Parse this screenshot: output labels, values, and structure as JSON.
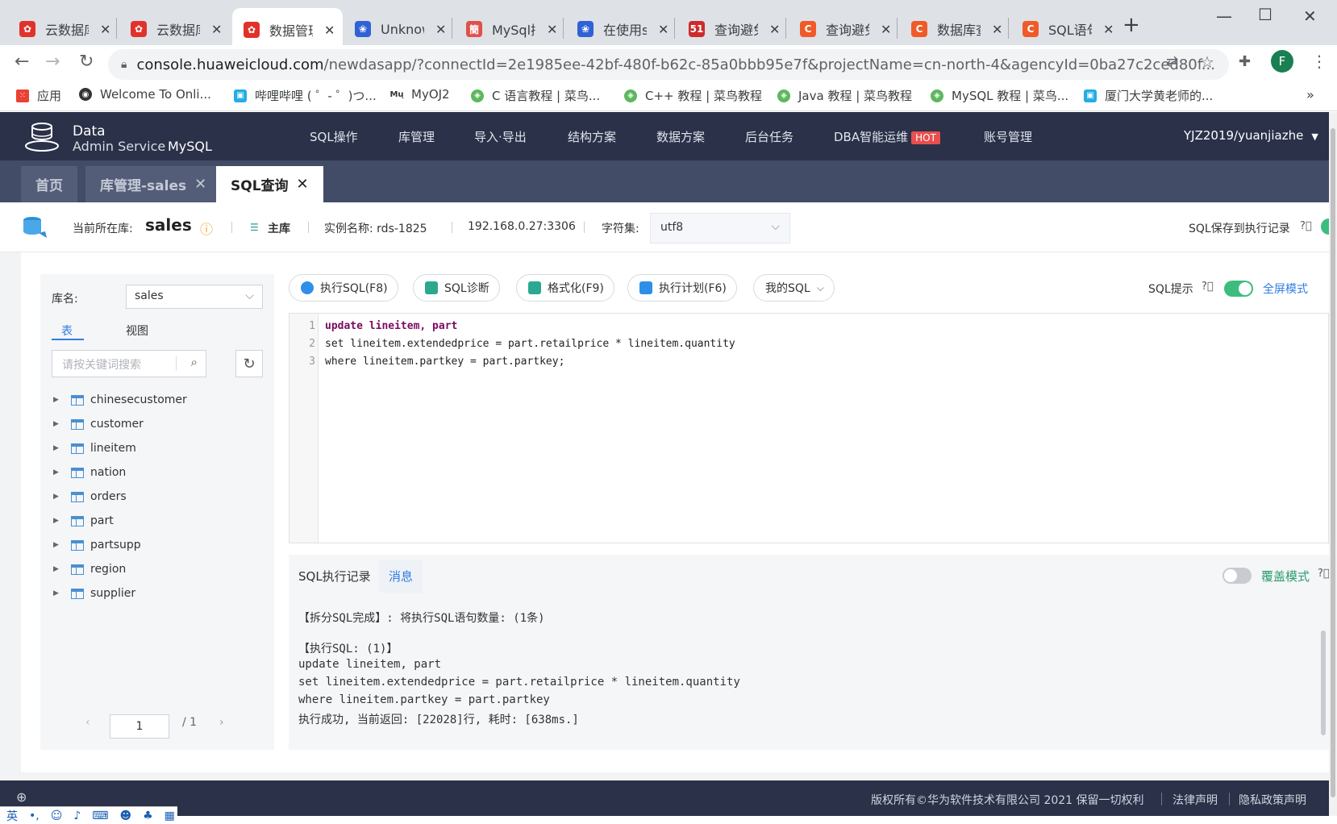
{
  "browser": {
    "tabs": [
      {
        "title": "云数据库",
        "color": "#e0322b",
        "glyph": "✿"
      },
      {
        "title": "云数据库",
        "color": "#e0322b",
        "glyph": "✿"
      },
      {
        "title": "数据管理",
        "color": "#e0322b",
        "glyph": "✿"
      },
      {
        "title": "Unknow",
        "color": "#3062d6",
        "glyph": "❀"
      },
      {
        "title": "MySql插",
        "color": "#e0504a",
        "glyph": "簡"
      },
      {
        "title": "在使用s",
        "color": "#3062d6",
        "glyph": "❀"
      },
      {
        "title": "查询避免",
        "color": "#cc2b2b",
        "glyph": "51"
      },
      {
        "title": "查询避免",
        "color": "#f05a28",
        "glyph": "C"
      },
      {
        "title": "数据库查",
        "color": "#f05a28",
        "glyph": "C"
      },
      {
        "title": "SQL语句",
        "color": "#f05a28",
        "glyph": "C"
      }
    ],
    "url_host": "console.huaweicloud.com",
    "url_path": "/newdasapp/?connectId=2e1985ee-42bf-480f-b62c-85a0bbb95e7f&projectName=cn-north-4&agencyId=0ba27c2ced80f...",
    "profile_initial": "F",
    "bookmarks": [
      {
        "label": "应用",
        "color": "#e94235"
      },
      {
        "label": "Welcome To Onli...",
        "color": "#333333"
      },
      {
        "label": "哔哩哔哩 ( ゜- ゜)つ...",
        "color": "#23ade5"
      },
      {
        "label": "MyOJ2",
        "color": "#333333"
      },
      {
        "label": "C 语言教程 | 菜鸟...",
        "color": "#5cb85c"
      },
      {
        "label": "C++ 教程 | 菜鸟教程",
        "color": "#5cb85c"
      },
      {
        "label": "Java 教程 | 菜鸟教程",
        "color": "#5cb85c"
      },
      {
        "label": "MySQL 教程 | 菜鸟...",
        "color": "#5cb85c"
      },
      {
        "label": "厦门大学黄老师的...",
        "color": "#23ade5"
      }
    ]
  },
  "app": {
    "brand_line1": "Data",
    "brand_line2": "Admin Service",
    "brand_product": "MySQL",
    "nav": [
      "SQL操作",
      "库管理",
      "导入·导出",
      "结构方案",
      "数据方案",
      "后台任务",
      "DBA智能运维",
      "账号管理"
    ],
    "hot_badge": "HOT",
    "user": "YJZ2019/yuanjiazhe"
  },
  "page_tabs": [
    {
      "label": "首页"
    },
    {
      "label": "库管理-sales"
    },
    {
      "label": "SQL查询"
    }
  ],
  "infobar": {
    "current_db_label": "当前所在库:",
    "current_db": "sales",
    "role": "主库",
    "instance": "实例名称: rds-1825",
    "address": "192.168.0.27:3306",
    "charset_label": "字符集:",
    "charset_value": "utf8",
    "save_history": "SQL保存到执行记录"
  },
  "sidebar": {
    "db_label": "库名:",
    "db_value": "sales",
    "tab_tables": "表",
    "tab_views": "视图",
    "search_placeholder": "请按关键词搜索",
    "tables": [
      "chinesecustomer",
      "customer",
      "lineitem",
      "nation",
      "orders",
      "part",
      "partsupp",
      "region",
      "supplier"
    ],
    "page_current": "1",
    "page_total": "/ 1"
  },
  "editor_toolbar": {
    "run": "执行SQL(F8)",
    "diagnose": "SQL诊断",
    "format": "格式化(F9)",
    "plan": "执行计划(F6)",
    "my_sql": "我的SQL",
    "sql_hint": "SQL提示",
    "fullscreen": "全屏模式"
  },
  "editor": {
    "line_numbers": [
      "1",
      "2",
      "3"
    ]
  },
  "results": {
    "tab_history": "SQL执行记录",
    "tab_messages": "消息",
    "overwrite_mode": "覆盖模式",
    "messages": [
      "【拆分SQL完成】: 将执行SQL语句数量: (1条)",
      "【执行SQL: (1)】",
      "update lineitem, part",
      "set lineitem.extendedprice = part.retailprice * lineitem.quantity",
      "where lineitem.partkey = part.partkey",
      "执行成功, 当前返回: [22028]行, 耗时: [638ms.]"
    ]
  },
  "footer": {
    "copyright": "版权所有©华为软件技术有限公司 2021 保留一切权利",
    "legal": "法律声明",
    "privacy": "隐私政策声明"
  },
  "colors": {
    "header_bg": "#2a3148",
    "accent_blue": "#2f7de1",
    "toggle_green": "#3dbd7d"
  }
}
